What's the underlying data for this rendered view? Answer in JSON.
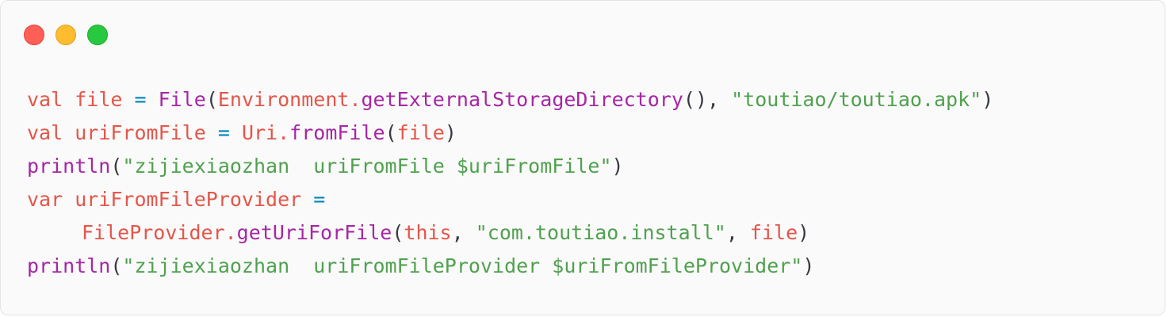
{
  "window": {
    "buttons": [
      {
        "name": "close",
        "color": "#ff5f57",
        "border": "#e0443e"
      },
      {
        "name": "minimize",
        "color": "#febc2e",
        "border": "#dea123"
      },
      {
        "name": "maximize",
        "color": "#28c840",
        "border": "#1aab29"
      }
    ]
  },
  "theme": {
    "background": "#fafafa",
    "keyword": "#e45649",
    "identifier": "#e45649",
    "operator": "#0184bc",
    "function": "#a626a4",
    "string": "#50a14f",
    "punctuation": "#383a42"
  },
  "code": {
    "lines": [
      {
        "indent": false,
        "tokens": [
          {
            "t": "val ",
            "k": "keyword"
          },
          {
            "t": "file",
            "k": "identifier"
          },
          {
            "t": " = ",
            "k": "operator"
          },
          {
            "t": "File",
            "k": "function"
          },
          {
            "t": "(",
            "k": "punctuation"
          },
          {
            "t": "Environment.",
            "k": "identifier"
          },
          {
            "t": "getExternalStorageDirectory",
            "k": "function"
          },
          {
            "t": "(), ",
            "k": "punctuation"
          },
          {
            "t": "\"toutiao/toutiao.apk\"",
            "k": "string"
          },
          {
            "t": ")",
            "k": "punctuation"
          }
        ]
      },
      {
        "indent": false,
        "tokens": [
          {
            "t": "val ",
            "k": "keyword"
          },
          {
            "t": "uriFromFile",
            "k": "identifier"
          },
          {
            "t": " = ",
            "k": "operator"
          },
          {
            "t": "Uri.",
            "k": "identifier"
          },
          {
            "t": "fromFile",
            "k": "function"
          },
          {
            "t": "(",
            "k": "punctuation"
          },
          {
            "t": "file",
            "k": "identifier"
          },
          {
            "t": ")",
            "k": "punctuation"
          }
        ]
      },
      {
        "indent": false,
        "tokens": [
          {
            "t": "println",
            "k": "function"
          },
          {
            "t": "(",
            "k": "punctuation"
          },
          {
            "t": "\"zijiexiaozhan  uriFromFile $uriFromFile\"",
            "k": "string"
          },
          {
            "t": ")",
            "k": "punctuation"
          }
        ]
      },
      {
        "indent": false,
        "tokens": [
          {
            "t": "var ",
            "k": "keyword"
          },
          {
            "t": "uriFromFileProvider",
            "k": "identifier"
          },
          {
            "t": " =",
            "k": "operator"
          }
        ]
      },
      {
        "indent": true,
        "tokens": [
          {
            "t": "FileProvider.",
            "k": "identifier"
          },
          {
            "t": "getUriForFile",
            "k": "function"
          },
          {
            "t": "(",
            "k": "punctuation"
          },
          {
            "t": "this",
            "k": "keyword"
          },
          {
            "t": ", ",
            "k": "punctuation"
          },
          {
            "t": "\"com.toutiao.install\"",
            "k": "string"
          },
          {
            "t": ", ",
            "k": "punctuation"
          },
          {
            "t": "file",
            "k": "identifier"
          },
          {
            "t": ")",
            "k": "punctuation"
          }
        ]
      },
      {
        "indent": false,
        "tokens": [
          {
            "t": "println",
            "k": "function"
          },
          {
            "t": "(",
            "k": "punctuation"
          },
          {
            "t": "\"zijiexiaozhan  uriFromFileProvider $uriFromFileProvider\"",
            "k": "string"
          },
          {
            "t": ")",
            "k": "punctuation"
          }
        ]
      }
    ]
  }
}
